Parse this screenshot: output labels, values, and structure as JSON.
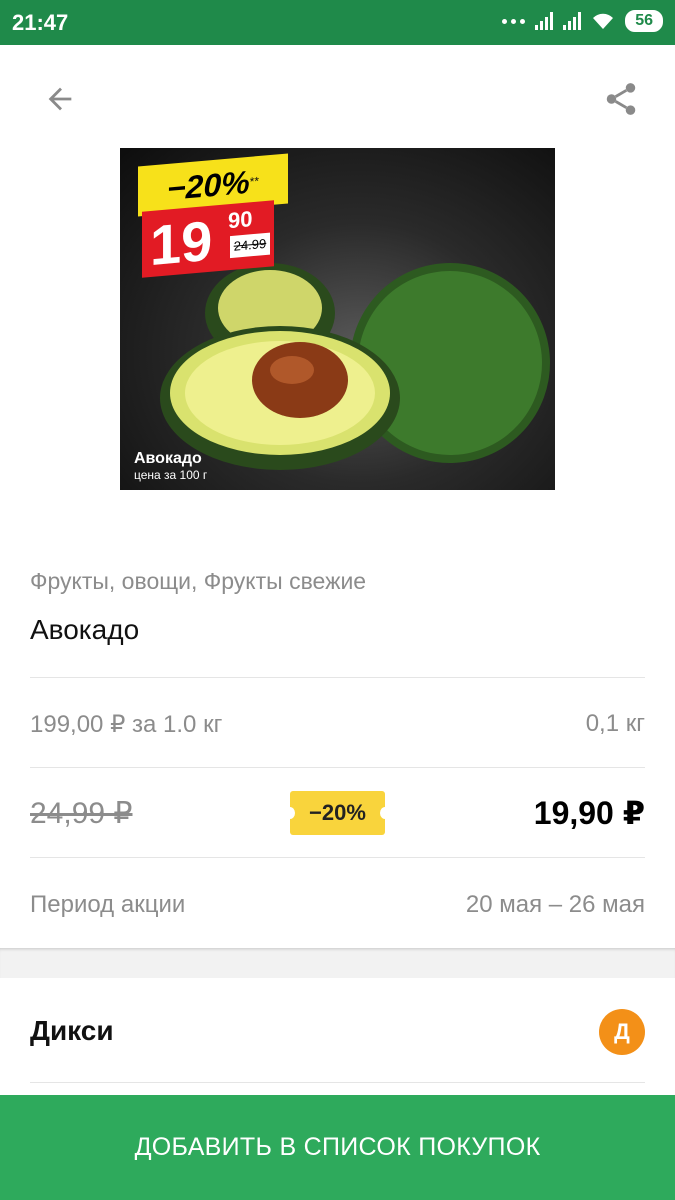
{
  "status_bar": {
    "time": "21:47",
    "battery": "56"
  },
  "icons": {
    "back": "arrow-left-icon",
    "share": "share-icon"
  },
  "image": {
    "promo_percent": "−20%",
    "promo_stars": "**",
    "promo_price_main": "19",
    "promo_price_kop": "90",
    "promo_old_price": "24.99",
    "caption_title": "Авокадо",
    "caption_sub": "цена за 100 г"
  },
  "product": {
    "category": "Фрукты, овощи, Фрукты свежие",
    "name": "Авокадо",
    "unit_price": "199,00 ₽ за 1.0 кг",
    "weight": "0,1 кг",
    "old_price": "24,99 ₽",
    "discount": "−20%",
    "new_price": "19,90 ₽",
    "period_label": "Период акции",
    "period_value": "20 мая – 26 мая"
  },
  "store": {
    "name": "Дикси",
    "logo_letter": "Д",
    "logo_color": "#f39018"
  },
  "actions": {
    "add_to_list": "ДОБАВИТЬ В СПИСОК ПОКУПОК"
  },
  "colors": {
    "status_bar": "#1f8a4a",
    "primary_button": "#2eaa5c",
    "discount_badge": "#f9d43c"
  }
}
